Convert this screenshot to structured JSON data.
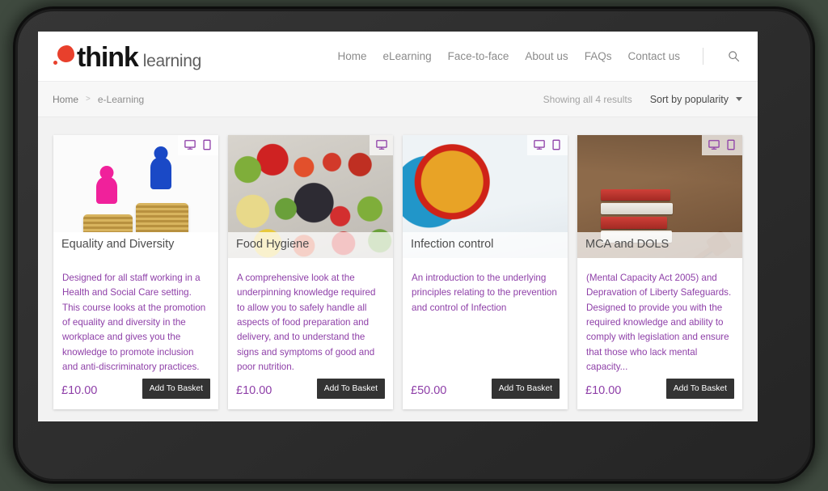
{
  "header": {
    "logo": {
      "primary": "think",
      "secondary": "learning",
      "mark": "red-blob-logo"
    },
    "nav": [
      {
        "label": "Home"
      },
      {
        "label": "eLearning"
      },
      {
        "label": "Face-to-face"
      },
      {
        "label": "About us"
      },
      {
        "label": "FAQs"
      },
      {
        "label": "Contact us"
      }
    ],
    "search_icon": "search-icon"
  },
  "breadcrumb": {
    "home": "Home",
    "separator": ">",
    "current": "e-Learning"
  },
  "toolbar": {
    "result_count": "Showing all 4 results",
    "sort_label": "Sort by popularity",
    "sort_options": [
      "Sort by popularity"
    ]
  },
  "theme": {
    "accent_purple": "#8e3fa8",
    "logo_red": "#e8402c",
    "button_dark": "#333333",
    "page_bg": "#f2f2f2",
    "device_frame": "#2b2b2b"
  },
  "products": [
    {
      "title": "Equality and Diversity",
      "description": "Designed for all staff working in a Health and Social Care setting. This course looks at the promotion of equality and diversity in the workplace and gives you the knowledge to promote inclusion and anti-discriminatory practices.",
      "price": "£10.00",
      "button": "Add To Basket",
      "devices": [
        "desktop-icon",
        "tablet-icon"
      ],
      "thumb_alt": "pink and blue game pawns on stacks of coins"
    },
    {
      "title": "Food Hygiene",
      "description": "A comprehensive look at the underpinning knowledge required to allow you to safely handle all aspects of food preparation and delivery, and to understand the signs and symptoms of good and poor nutrition.",
      "price": "£10.00",
      "button": "Add To Basket",
      "devices": [
        "desktop-icon"
      ],
      "thumb_alt": "assorted fresh vegetables on a surface"
    },
    {
      "title": "Infection control",
      "description": "An introduction to the underlying principles relating to the prevention and control of Infection",
      "price": "£50.00",
      "button": "Add To Basket",
      "devices": [
        "desktop-icon",
        "tablet-icon"
      ],
      "thumb_alt": "gloved hand holding a petri dish culture in a lab"
    },
    {
      "title": "MCA and DOLS",
      "description": "(Mental Capacity Act 2005) and Depravation of Liberty Safeguards. Designed to provide you with the required knowledge and ability to comply with legislation and ensure that those who lack mental capacity...",
      "price": "£10.00",
      "button": "Add To Basket",
      "devices": [
        "desktop-icon",
        "tablet-icon"
      ],
      "thumb_alt": "stack of red law books with a wooden gavel"
    }
  ]
}
